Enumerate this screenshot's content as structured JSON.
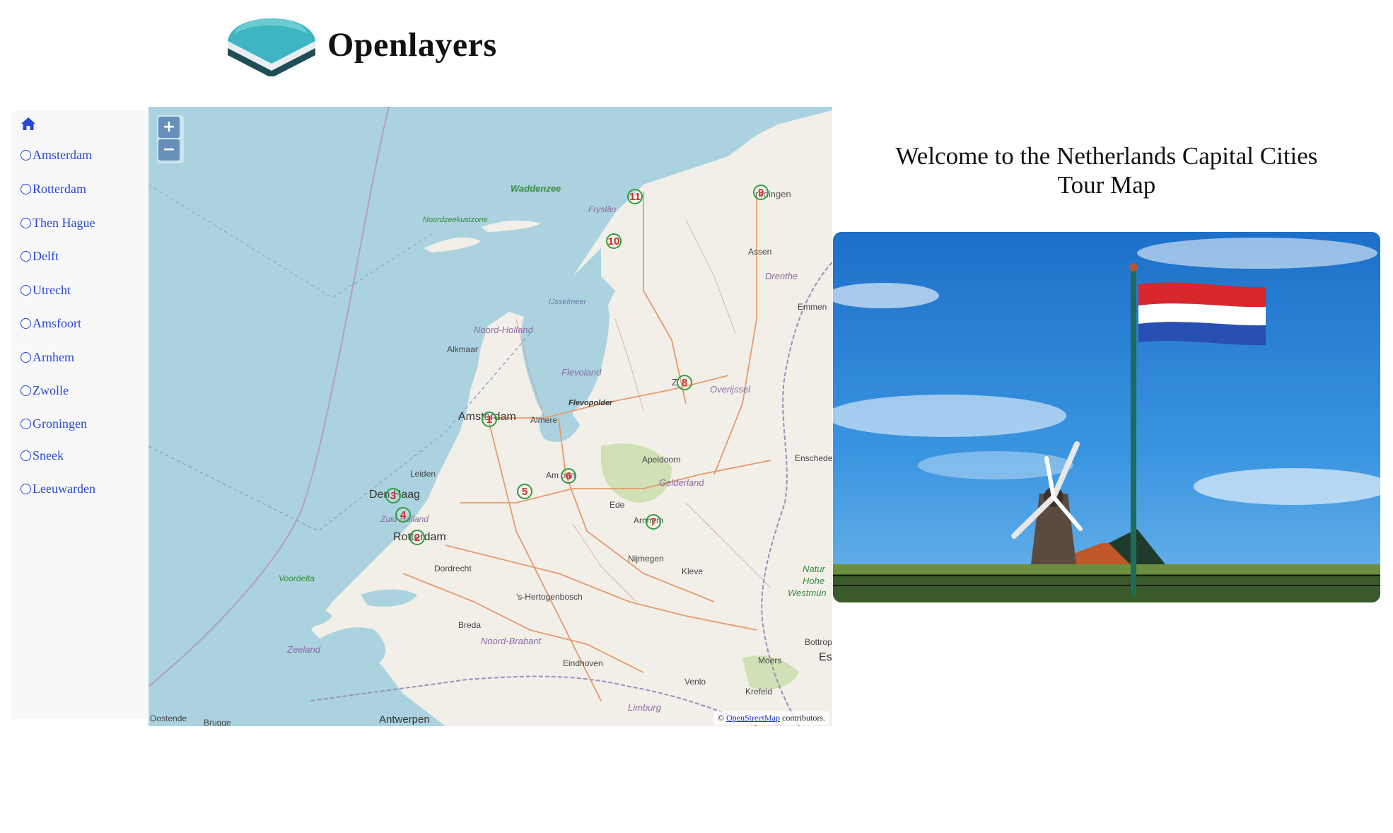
{
  "header": {
    "brand": "Openlayers",
    "logo_icon": "openlayers-logo-icon"
  },
  "sidebar": {
    "home_icon": "home-icon",
    "items": [
      {
        "label": "Amsterdam"
      },
      {
        "label": "Rotterdam"
      },
      {
        "label": "Then Hague"
      },
      {
        "label": "Delft"
      },
      {
        "label": "Utrecht"
      },
      {
        "label": "Amsfoort"
      },
      {
        "label": "Arnhem"
      },
      {
        "label": "Zwolle"
      },
      {
        "label": "Groningen"
      },
      {
        "label": "Sneek"
      },
      {
        "label": "Leeuwarden"
      }
    ]
  },
  "map": {
    "zoom_in": "+",
    "zoom_out": "−",
    "attribution_prefix": "©",
    "attribution_link": "OpenStreetMap",
    "attribution_suffix": "contributors.",
    "markers": [
      "1",
      "2",
      "3",
      "4",
      "5",
      "6",
      "7",
      "8",
      "9",
      "10",
      "11"
    ],
    "place_labels": {
      "waddenzee": "Waddenzee",
      "noordzeekustzone": "Noordzeekustzone",
      "fryslan": "Fryslân",
      "groningen": "roningen",
      "assen": "Assen",
      "drenthe": "Drenthe",
      "emmen": "Emmen",
      "ijsselmeer": "IJsselmeer",
      "noord_holland": "Noord-Holland",
      "alkmaar": "Alkmaar",
      "flevoland": "Flevoland",
      "flevopolder": "Flevopolder",
      "zwolle": "Z",
      "overijssel": "Overijssel",
      "amsterdam": "Amsterdam",
      "almere": "Almere",
      "apeldoorn": "Apeldoorn",
      "enschede": "Enschede",
      "leiden": "Leiden",
      "den_haag": "Den Haag",
      "amersfoort": "Am  oort",
      "gelderland": "Gelderland",
      "ede": "Ede",
      "zuid_holland": "Zuid-Holland",
      "rotterdam": "Rotterdam",
      "arnhem": "Arnhem",
      "dordrecht": "Dordrecht",
      "nijmegen": "Nijmegen",
      "kleve": "Kleve",
      "voordelta": "Voordelta",
      "hertogenbosch": "'s-Hertogenbosch",
      "natur": "Natur",
      "hohe": "Hohe",
      "westmu": "Westmün",
      "breda": "Breda",
      "noord_brabant": "Noord-Brabant",
      "zeeland": "Zeeland",
      "bottrop": "Bottrop",
      "eindhoven": "Eindhoven",
      "moers": "Moers",
      "ess": "Ess",
      "venlo": "Venlo",
      "krefeld": "Krefeld",
      "limburg": "Limburg",
      "oostende": "Oostende",
      "brugge": "Brugge",
      "antwerpen": "Antwerpen"
    }
  },
  "welcome": {
    "line1": "Welcome to the Netherlands Capital Cities",
    "line2": "Tour Map"
  },
  "photo": {
    "subject": "dutch-flag-and-windmill-photo",
    "flag_colors": [
      "#d8262d",
      "#ffffff",
      "#2a4fb4"
    ],
    "sky_color": "#2d86d8"
  }
}
